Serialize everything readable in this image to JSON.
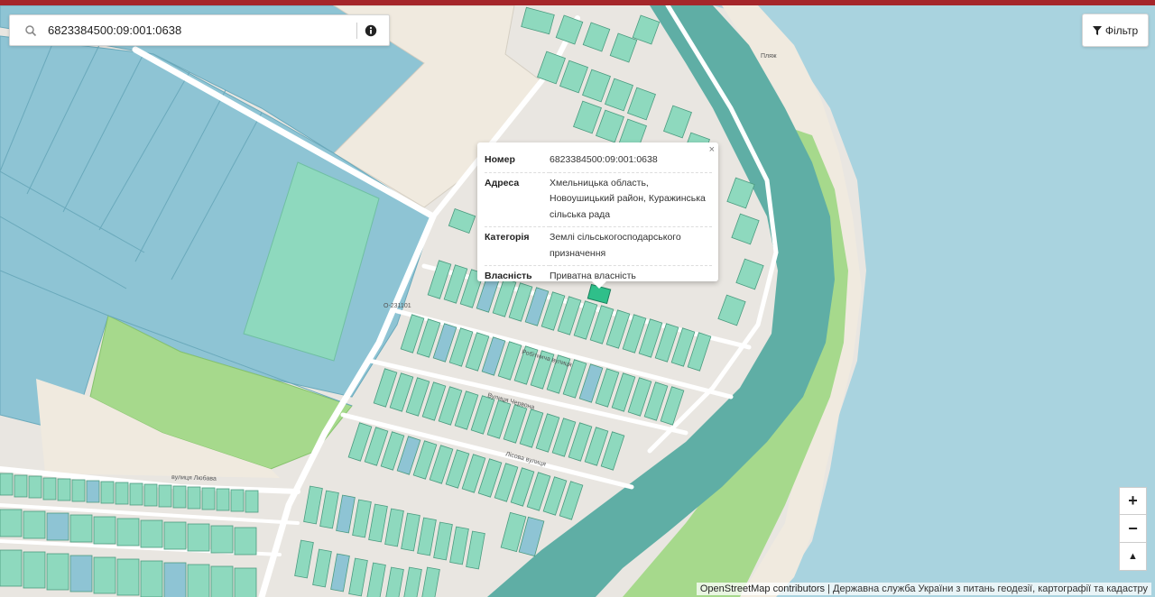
{
  "search": {
    "value": "6823384500:09:001:0638",
    "search_icon": "search-icon",
    "info_icon": "info-icon"
  },
  "filter": {
    "label": "Фільтр",
    "icon": "funnel-icon"
  },
  "popup": {
    "close": "×",
    "rows": [
      {
        "key": "Номер",
        "value": "6823384500:09:001:0638"
      },
      {
        "key": "Адреса",
        "value": "Хмельницька область, Новоушицький район, Куражинська сільська рада"
      },
      {
        "key": "Категорія",
        "value": "Землі сільськогосподарського призначення"
      },
      {
        "key": "Власність",
        "value": "Приватна власність"
      }
    ]
  },
  "zoom": {
    "in": "+",
    "out": "−",
    "north": "▲"
  },
  "attribution": {
    "osm": "OpenStreetMap contributors",
    "sep": " | ",
    "agency": "Державна служба України з питань геодезії, картографії та кадастру"
  },
  "map_labels": {
    "street1": "вулиця Любава",
    "street2": "Робітнича вулиця",
    "street3": "Вулиця Червона",
    "street4": "Лісова вулиця",
    "road": "О-231101",
    "beach": "Пляж"
  },
  "colors": {
    "water": "#a9d3df",
    "river_band": "#5faea5",
    "parcel_blue": "#8ec4d4",
    "parcel_green": "#8ed9be",
    "parcel_small": "#7fcfb0",
    "selected": "#2fbf8a",
    "grass": "#a6d98c",
    "sand": "#f0eadf",
    "road": "#ffffff"
  }
}
